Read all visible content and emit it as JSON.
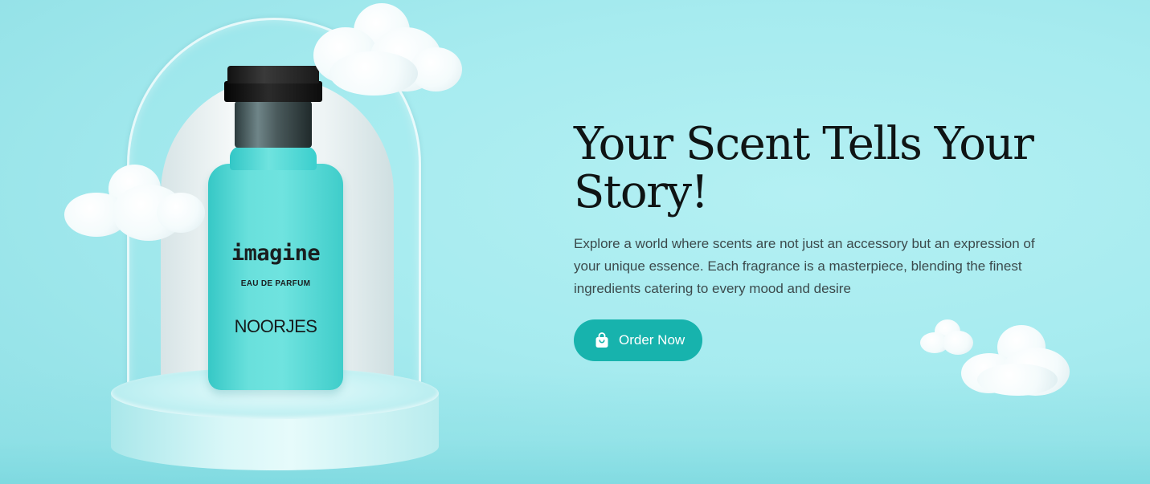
{
  "hero": {
    "headline": "Your Scent Tells Your Story!",
    "description": "Explore a world where scents are not just an accessory but an expression of your unique essence. Each fragrance is a masterpiece, blending the finest ingredients catering to every mood and desire",
    "cta": {
      "label": "Order Now",
      "icon": "shopping-bag-icon"
    }
  },
  "product": {
    "name": "imagine",
    "type": "EAU DE PARFUM",
    "brand": "NOORJES"
  },
  "colors": {
    "background": "#a6ebef",
    "accent": "#17b3ad",
    "bottle": "#6fe3df",
    "headline": "#0f1414",
    "body_text": "#3c4a4c"
  }
}
